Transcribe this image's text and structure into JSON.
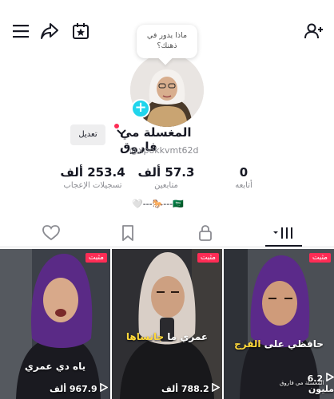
{
  "bubble": {
    "text": "ماذا يدور في ذهنك؟"
  },
  "profile": {
    "name": "المغسلة مي فاروق",
    "handle": "@xpokkvmt62d",
    "edit_label": "تعديل",
    "bio": "🤍---🐎---🇸🇦"
  },
  "stats": [
    {
      "value": "0",
      "label": "أتابعه"
    },
    {
      "value": "57.3 ألف",
      "label": "متابعين"
    },
    {
      "value": "253.4 ألف",
      "label": "تسجيلات الإعجاب"
    }
  ],
  "videos": [
    {
      "pinned": "مثبت",
      "caption_white": "حافظي على",
      "caption_yellow": "الفرج",
      "views": "6.2 مليون",
      "overlay": "المغسلة مي فاروق"
    },
    {
      "pinned": "مثبت",
      "caption_white": "عمري ما",
      "caption_yellow": "جانساها",
      "views": "788.2 ألف"
    },
    {
      "pinned": "مثبت",
      "caption_white": "ياه دي عمري",
      "caption_yellow": "",
      "views": "967.9 ألف"
    }
  ],
  "colors": {
    "accent": "#fe2c55",
    "plus": "#20d5ec",
    "caption_yellow": "#ffd83a"
  }
}
